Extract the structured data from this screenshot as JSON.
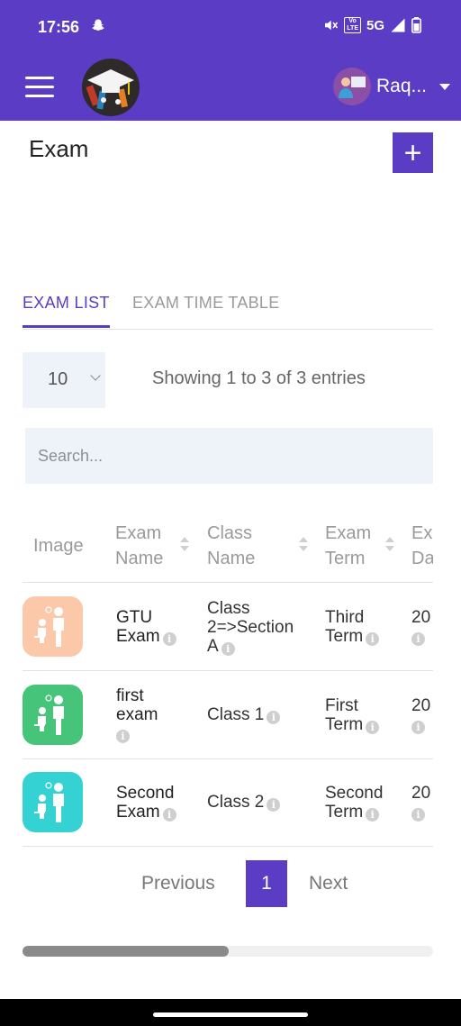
{
  "status_bar": {
    "time": "17:56",
    "network": "5G",
    "volte_top": "Vo",
    "volte_bottom": "LTE"
  },
  "header": {
    "user_name": "Raq..."
  },
  "page": {
    "title": "Exam",
    "add_label": "+"
  },
  "tabs": [
    {
      "label": "EXAM LIST",
      "active": true
    },
    {
      "label": "EXAM TIME TABLE",
      "active": false
    }
  ],
  "table_controls": {
    "page_length": "10",
    "info": "Showing 1 to 3 of 3 entries",
    "search_placeholder": "Search..."
  },
  "table": {
    "columns": [
      {
        "line1": "Image",
        "line2": ""
      },
      {
        "line1": "Exam",
        "line2": "Name"
      },
      {
        "line1": "Class",
        "line2": "Name"
      },
      {
        "line1": "Exam",
        "line2": "Term"
      },
      {
        "line1": "Exa",
        "line2": "Da"
      }
    ],
    "rows": [
      {
        "thumb_color": "#fbc9a9",
        "name_l1": "GTU",
        "name_l2": "Exam",
        "class_l1": "Class",
        "class_l2": "2=>Section",
        "class_l3": "A",
        "term_l1": "Third",
        "term_l2": "Term",
        "date": "20"
      },
      {
        "thumb_color": "#45c47a",
        "name_l1": "first",
        "name_l2": "exam",
        "class_l1": "Class 1",
        "term_l1": "First",
        "term_l2": "Term",
        "date": "20"
      },
      {
        "thumb_color": "#34d2d2",
        "name_l1": "Second",
        "name_l2": "Exam",
        "class_l1": "Class 2",
        "term_l1": "Second",
        "term_l2": "Term",
        "date": "20"
      }
    ]
  },
  "pagination": {
    "previous": "Previous",
    "current": "1",
    "next": "Next"
  },
  "colors": {
    "primary": "#5b3cc4",
    "input_bg": "#eef2f9"
  },
  "icons": [
    "snapchat-icon",
    "mute-icon",
    "signal-icon",
    "battery-icon",
    "menu-icon",
    "plus-icon",
    "info-icon",
    "sort-icon",
    "chevron-down-icon",
    "teacher-student-icon"
  ]
}
